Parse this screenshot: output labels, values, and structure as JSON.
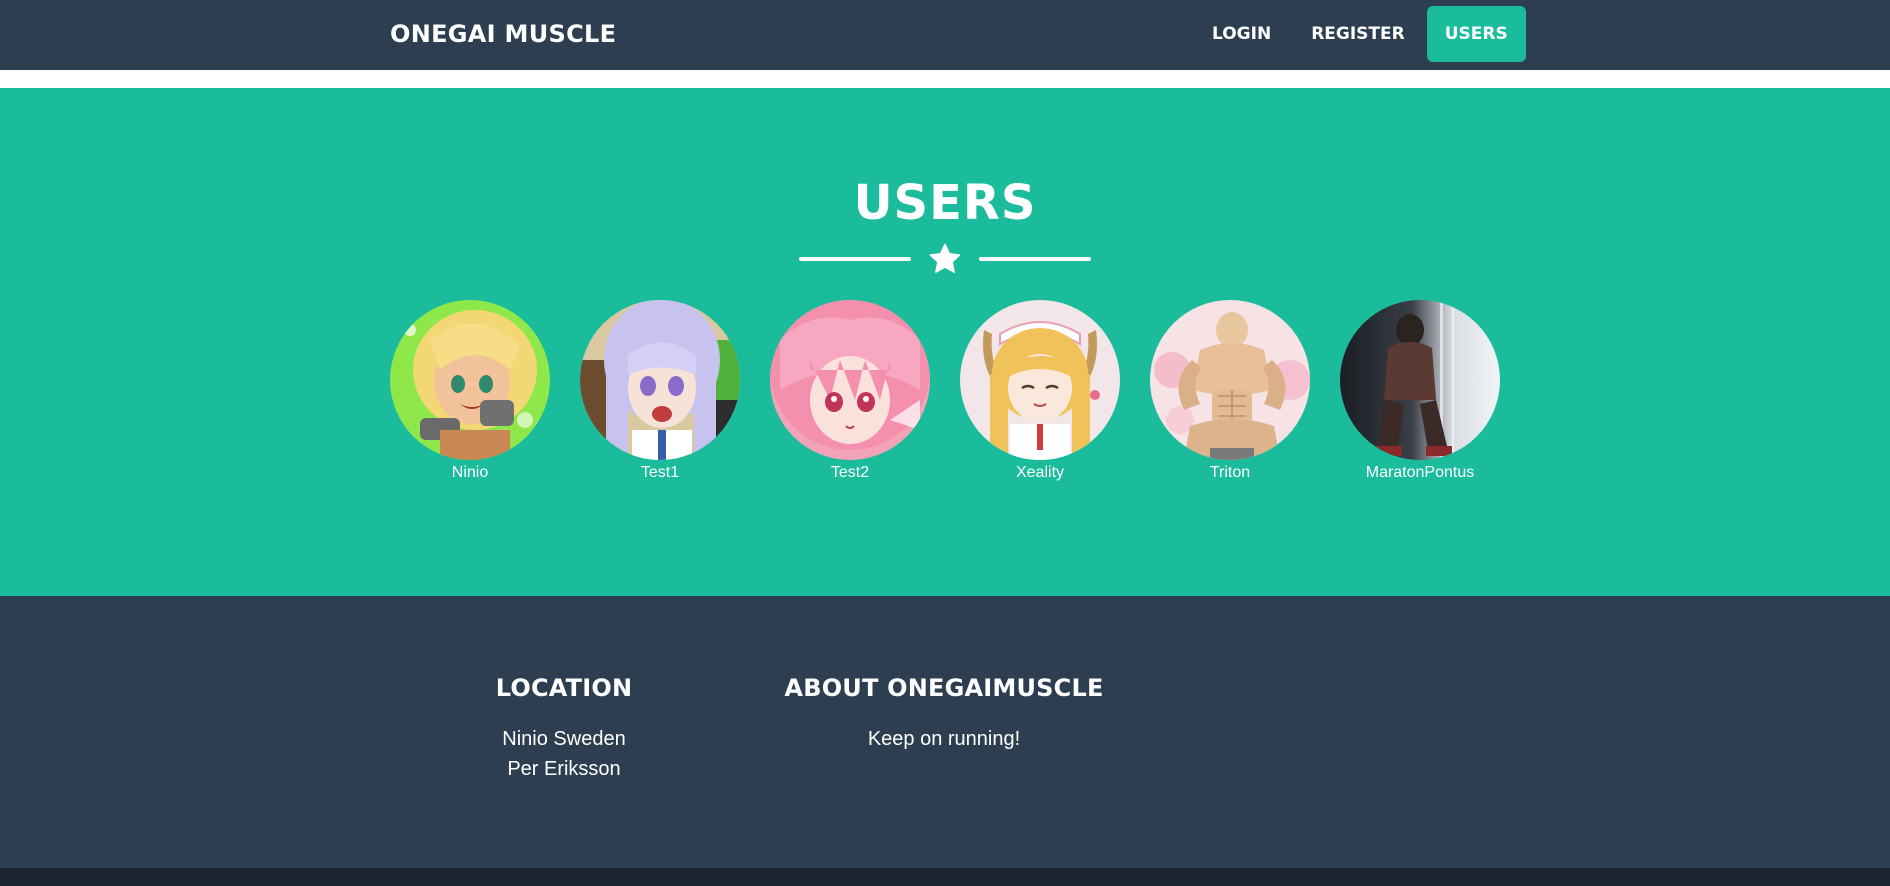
{
  "navbar": {
    "brand": "ONEGAI MUSCLE",
    "links": [
      {
        "label": "LOGIN",
        "active": false
      },
      {
        "label": "REGISTER",
        "active": false
      },
      {
        "label": "USERS",
        "active": true
      }
    ]
  },
  "users_section": {
    "title": "USERS",
    "divider_icon": "star-icon",
    "users": [
      {
        "name": "Ninio",
        "avatar": "anime-girl-blonde-avatar"
      },
      {
        "name": "Test1",
        "avatar": "anime-girl-lavender-hair-avatar"
      },
      {
        "name": "Test2",
        "avatar": "anime-girl-pink-hair-avatar"
      },
      {
        "name": "Xeality",
        "avatar": "anime-maid-dragon-avatar"
      },
      {
        "name": "Triton",
        "avatar": "muscular-man-avatar"
      },
      {
        "name": "MaratonPontus",
        "avatar": "dark-figure-avatar"
      }
    ]
  },
  "footer": {
    "location": {
      "heading": "LOCATION",
      "lines": [
        "Ninio Sweden",
        "Per Eriksson"
      ]
    },
    "about": {
      "heading": "ABOUT ONEGAIMUSCLE",
      "text": "Keep on running!"
    }
  },
  "colors": {
    "navbar_bg": "#2c3e50",
    "accent": "#1abc9c",
    "footer_bg": "#2c3e50",
    "bottom_bar": "#1a252f",
    "text": "#ffffff"
  }
}
